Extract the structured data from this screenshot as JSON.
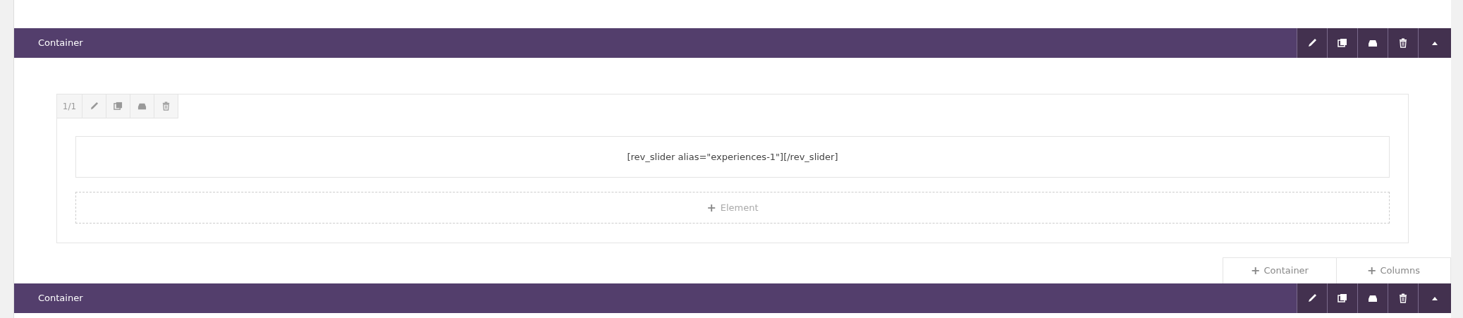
{
  "containers": [
    {
      "title": "Container",
      "collapsed": false,
      "columns": [
        {
          "width_label": "1/1",
          "elements": [
            {
              "text": "[rev_slider alias=\"experiences-1\"][/rev_slider]"
            }
          ],
          "add_element": {
            "icon": "+",
            "label": "Element"
          }
        }
      ],
      "add_buttons": [
        {
          "icon": "+",
          "label": "Container"
        },
        {
          "icon": "+",
          "label": "Columns"
        }
      ]
    },
    {
      "title": "Container",
      "collapsed": false
    }
  ]
}
